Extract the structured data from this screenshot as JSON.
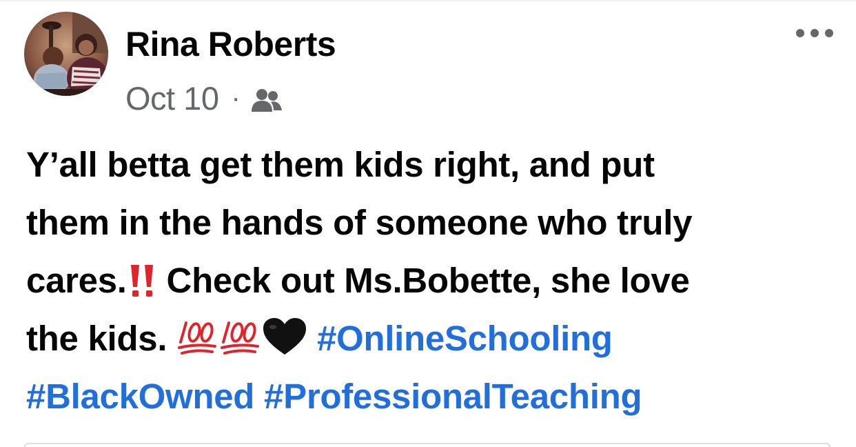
{
  "author": {
    "name": "Rina Roberts",
    "avatar_icon": "profile-photo"
  },
  "meta": {
    "date": "Oct 10",
    "separator": "·",
    "audience_icon": "friends-icon"
  },
  "more_icon": "more-horizontal-icon",
  "post": {
    "line1": "Y’all betta get them kids right, and put",
    "line2": "them in the hands of someone who truly",
    "line3_before": "cares.",
    "line3_emoji": "double-exclamation-emoji",
    "line3_after": " Check out Ms.Bobette, she love",
    "line4_before": "the kids. ",
    "line4_emojis": [
      "hundred-points-emoji",
      "hundred-points-emoji",
      "black-heart-emoji"
    ],
    "hashtag1": "#OnlineSchooling",
    "hashtag2": "#BlackOwned",
    "hashtag3": "#ProfessionalTeaching"
  },
  "colors": {
    "text": "#050505",
    "meta": "#65676b",
    "hashtag": "#216fdb",
    "emoji_red": "#e0242b",
    "heart": "#111111"
  }
}
